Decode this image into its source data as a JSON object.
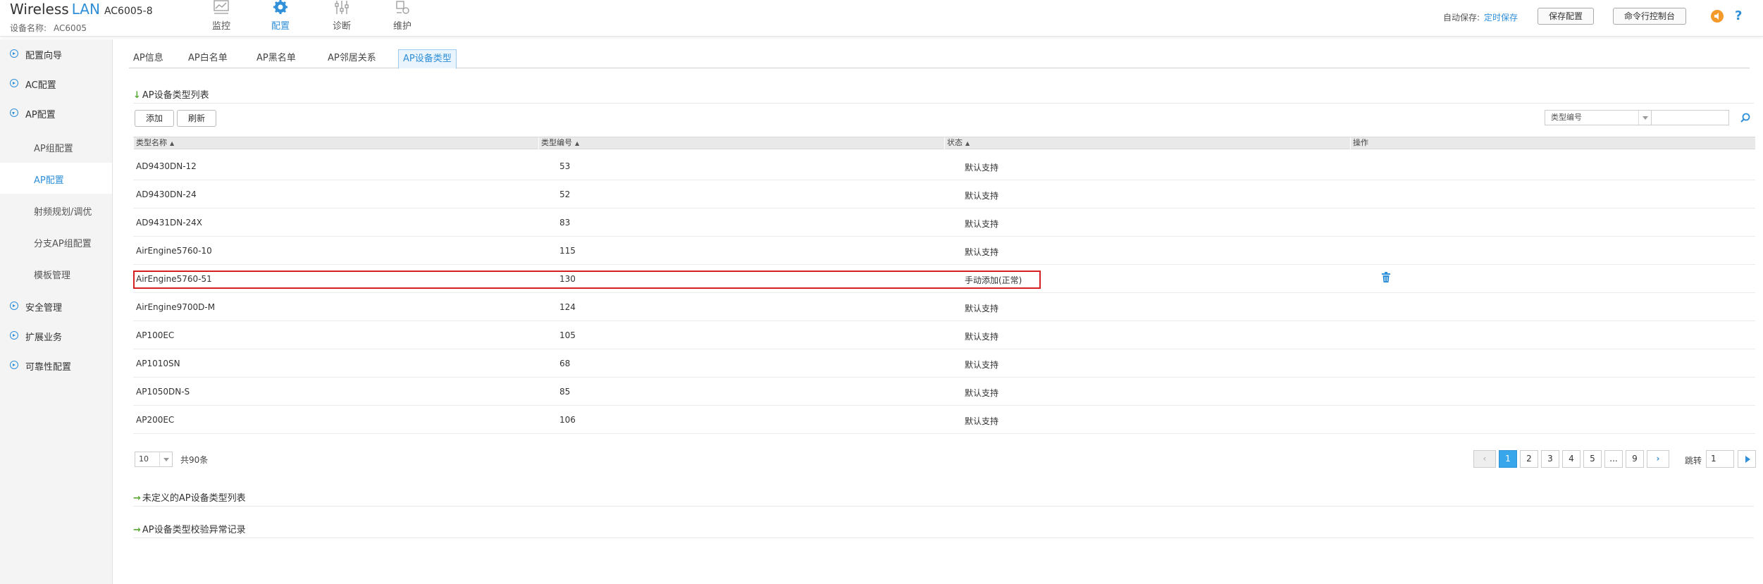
{
  "header": {
    "brand_wireless": "Wireless",
    "brand_lan": "LAN",
    "brand_model": "AC6005-8",
    "device_label": "设备名称:",
    "device_value": "AC6005",
    "nav": [
      {
        "label": "监控",
        "icon": "monitor-icon"
      },
      {
        "label": "配置",
        "icon": "gear-icon",
        "active": true
      },
      {
        "label": "诊断",
        "icon": "diagnose-icon"
      },
      {
        "label": "维护",
        "icon": "maintain-icon"
      }
    ],
    "autosave_label": "自动保存:",
    "autosave_link": "定时保存",
    "save_button": "保存配置",
    "console_button": "命令行控制台",
    "speaker_icon": "speaker-icon",
    "help_icon": "?"
  },
  "sidebar": {
    "items": [
      {
        "label": "配置向导"
      },
      {
        "label": "AC配置"
      },
      {
        "label": "AP配置",
        "open": true
      },
      {
        "label": "AP组配置"
      },
      {
        "label": "AP配置",
        "active": true
      },
      {
        "label": "射频规划/调优"
      },
      {
        "label": "分支AP组配置"
      },
      {
        "label": "模板管理"
      },
      {
        "label": "安全管理"
      },
      {
        "label": "扩展业务"
      },
      {
        "label": "可靠性配置"
      }
    ]
  },
  "tabs": [
    {
      "label": "AP信息"
    },
    {
      "label": "AP白名单"
    },
    {
      "label": "AP黑名单"
    },
    {
      "label": "AP邻居关系"
    },
    {
      "label": "AP设备类型",
      "active": true
    }
  ],
  "section": {
    "title": "AP设备类型列表",
    "add_button": "添加",
    "refresh_button": "刷新",
    "filter_select": "类型编号",
    "filter_input": ""
  },
  "table": {
    "headers": [
      "类型名称",
      "类型编号",
      "状态",
      "操作"
    ],
    "rows": [
      [
        "AD9430DN-12",
        "53",
        "默认支持"
      ],
      [
        "AD9430DN-24",
        "52",
        "默认支持"
      ],
      [
        "AD9431DN-24X",
        "83",
        "默认支持"
      ],
      [
        "AirEngine5760-10",
        "115",
        "默认支持"
      ],
      [
        "AirEngine5760-51",
        "130",
        "手动添加(正常)"
      ],
      [
        "AirEngine9700D-M",
        "124",
        "默认支持"
      ],
      [
        "AP100EC",
        "105",
        "默认支持"
      ],
      [
        "AP1010SN",
        "68",
        "默认支持"
      ],
      [
        "AP1050DN-S",
        "85",
        "默认支持"
      ],
      [
        "AP200EC",
        "106",
        "默认支持"
      ]
    ]
  },
  "pager": {
    "page_size": "10",
    "total": "共90条",
    "pages": [
      "1",
      "2",
      "3",
      "4",
      "5",
      "...",
      "9"
    ],
    "current": "1",
    "jump_label": "跳转",
    "jump_value": "1"
  },
  "sections_collapsed": [
    {
      "title": "未定义的AP设备类型列表"
    },
    {
      "title": "AP设备类型校验异常记录"
    }
  ],
  "colors": {
    "accent": "#2f8fd8",
    "highlight_border": "#d62020",
    "active_page": "#37a6ea",
    "section_arrow": "#5aa934"
  }
}
